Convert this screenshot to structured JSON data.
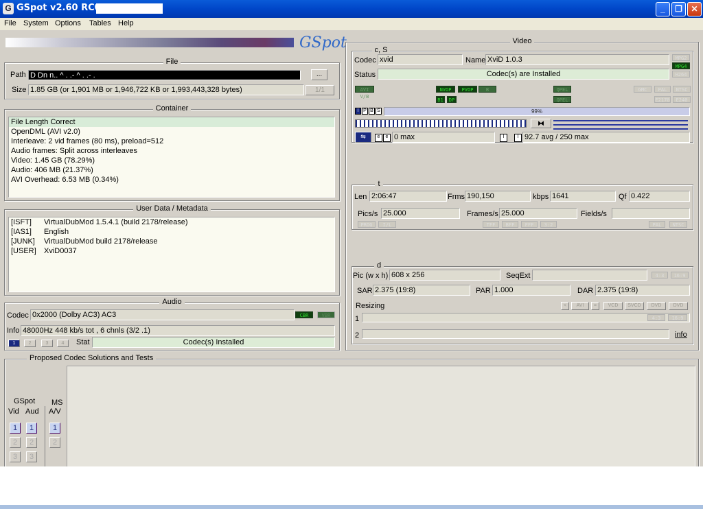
{
  "window": {
    "title": "GSpot v2.60 RC01:",
    "minimize": "_",
    "restore": "❐",
    "close": "✕"
  },
  "menu": [
    "File",
    "System",
    "Options",
    "Tables",
    "Help"
  ],
  "logo": "GSpot",
  "file": {
    "title": "File",
    "path_label": "Path",
    "path_value": "D Dn n.. ^ . .- ^ . .- .",
    "browse": "...",
    "size_label": "Size",
    "size_value": "1.85 GB (or 1,901 MB or 1,946,722 KB or 1,993,443,328 bytes)",
    "page": "1/1"
  },
  "container": {
    "title": "Container",
    "lines": [
      "File Length Correct",
      "OpenDML (AVI v2.0)",
      "Interleave: 2 vid frames (80 ms), preload=512",
      "Audio frames: Split across interleaves",
      "Video: 1.45 GB (78.29%)",
      "Audio: 406 MB (21.37%)",
      "AVI Overhead: 6.53 MB (0.34%)"
    ]
  },
  "userdata": {
    "title": "User Data / Metadata",
    "rows": [
      {
        "tag": "[ISFT]",
        "value": "VirtualDubMod 1.5.4.1 (build 2178/release)"
      },
      {
        "tag": "[IAS1]",
        "value": "English"
      },
      {
        "tag": "[JUNK]",
        "value": "VirtualDubMod build 2178/release"
      },
      {
        "tag": "[USER]",
        "value": "XviD0037"
      }
    ]
  },
  "audio": {
    "title": "Audio",
    "codec_label": "Codec",
    "codec_value": "0x2000 (Dolby AC3) AC3",
    "cbr": "CBR",
    "vbr": "VBR",
    "info_label": "Info",
    "info_value": "48000Hz  448 kb/s tot , 6 chnls (3/2 .1)",
    "stream_buttons": [
      "1",
      "2",
      "3",
      "4"
    ],
    "stat_label": "Stat",
    "stat_value": "Codec(s) Installed"
  },
  "video": {
    "title": "Video",
    "cs": {
      "title": "c, S",
      "codec_label": "Codec",
      "codec_value": "xvid",
      "name_label": "Name",
      "name_value": "XviD 1.0.3",
      "status_label": "Status",
      "status_value": "Codec(s) are Installed",
      "badges": [
        "MPG2",
        "MPG4",
        "H264"
      ]
    },
    "flags_row1": [
      "AVI V/B",
      "NVOP",
      "PVOP",
      "B",
      "QPEL",
      "GMC",
      "I709",
      "PAL",
      "NTSC"
    ],
    "flags_row2": [
      "B1",
      "DP",
      "QPEL",
      "I709",
      "E2170",
      "E240"
    ],
    "frame_types": [
      "I",
      "P",
      "B",
      "S"
    ],
    "percent": "99%",
    "bframes": "0 max",
    "kbps_max": "92.7 avg / 250 max"
  },
  "t": {
    "title": "t",
    "len_label": "Len",
    "len_value": "2:06:47",
    "frms_label": "Frms",
    "frms_value": "190,150",
    "kbps_label": "kbps",
    "kbps_value": "1641",
    "qf_label": "Qf",
    "qf_value": "0.422",
    "pics_label": "Pics/s",
    "pics_value": "25.000",
    "frames_label": "Frames/s",
    "frames_value": "25.000",
    "fields_label": "Fields/s",
    "fields_value": "",
    "flags": [
      "PROG",
      "I/L",
      "TFF",
      "BFF",
      "FFF",
      "3:2",
      "PAL",
      "NTSC"
    ]
  },
  "d": {
    "title": "d",
    "pic_label": "Pic (w x h)",
    "pic_value": "608 x 256",
    "seqext_label": "SeqExt",
    "seqext_value": "",
    "ratio_btns": [
      "4:3",
      "16:9"
    ],
    "sar_label": "SAR",
    "sar_value": "2.375 (19:8)",
    "par_label": "PAR",
    "par_value": "1.000",
    "dar_label": "DAR",
    "dar_value": "2.375 (19:8)",
    "resizing_label": "Resizing",
    "resize_btns": [
      "<",
      "AVI",
      "=",
      "VCD",
      "SVCD",
      "DVD",
      "DVD"
    ],
    "r1": "1",
    "r2": "2",
    "info_link": "info",
    "r_btns": [
      "4:3",
      "16:9"
    ]
  },
  "proposed": {
    "title": "Proposed Codec Solutions and Tests",
    "gspot_label": "GSpot",
    "vid_label": "Vid",
    "aud_label": "Aud",
    "ms_label": "MS",
    "av_label": "A/V",
    "nums": [
      "1",
      "2",
      "3"
    ]
  }
}
